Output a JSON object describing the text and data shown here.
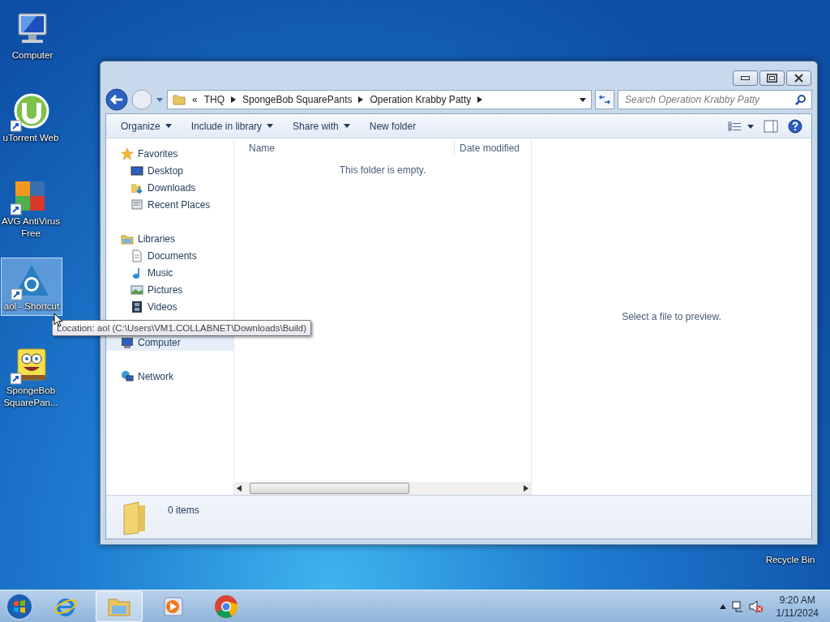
{
  "desktop_icons": [
    {
      "kind": "computer",
      "label": "Computer",
      "selected": false
    },
    {
      "kind": "utorrent",
      "label": "uTorrent Web",
      "selected": false
    },
    {
      "kind": "avg",
      "label": "AVG AntiVirus Free",
      "selected": false
    },
    {
      "kind": "aol",
      "label": "aol - Shortcut",
      "selected": true
    },
    {
      "kind": "spongebob",
      "label": "SpongeBob SquarePan...",
      "selected": false
    },
    {
      "kind": "recycle",
      "label": "Recycle Bin",
      "selected": false
    }
  ],
  "tooltip": {
    "text": "Location: aol (C:\\Users\\VM1.COLLABNET\\Downloads\\Build)"
  },
  "explorer": {
    "address": {
      "overflow": "«",
      "segments": [
        "THQ",
        "SpongeBob SquarePants",
        "Operation Krabby Patty"
      ]
    },
    "search": {
      "placeholder": "Search Operation Krabby Patty"
    },
    "toolbar": [
      {
        "label": "Organize",
        "dropdown": true
      },
      {
        "label": "Include in library",
        "dropdown": true
      },
      {
        "label": "Share with",
        "dropdown": true
      },
      {
        "label": "New folder",
        "dropdown": false
      }
    ],
    "nav": [
      {
        "kind": "favorites",
        "label": "Favorites",
        "selected": false,
        "children": [
          {
            "kind": "desktop",
            "label": "Desktop",
            "selected": false
          },
          {
            "kind": "downloads",
            "label": "Downloads",
            "selected": false
          },
          {
            "kind": "recent",
            "label": "Recent Places",
            "selected": false
          }
        ]
      },
      {
        "kind": "libraries",
        "label": "Libraries",
        "selected": false,
        "children": [
          {
            "kind": "documents",
            "label": "Documents",
            "selected": false
          },
          {
            "kind": "music",
            "label": "Music",
            "selected": false
          },
          {
            "kind": "pictures",
            "label": "Pictures",
            "selected": false
          },
          {
            "kind": "videos",
            "label": "Videos",
            "selected": false
          }
        ]
      },
      {
        "kind": "computer",
        "label": "Computer",
        "selected": true
      },
      {
        "kind": "network",
        "label": "Network",
        "selected": false
      }
    ],
    "columns": [
      "Name",
      "Date modified"
    ],
    "empty_message": "This folder is empty.",
    "preview_message": "Select a file to preview.",
    "status": "0 items"
  },
  "taskbar": {
    "items": [
      {
        "kind": "ie",
        "active": false
      },
      {
        "kind": "explorer",
        "active": true
      },
      {
        "kind": "media",
        "active": false
      },
      {
        "kind": "chrome",
        "active": false
      }
    ],
    "time": "9:20 AM",
    "date": "1/11/2024"
  }
}
